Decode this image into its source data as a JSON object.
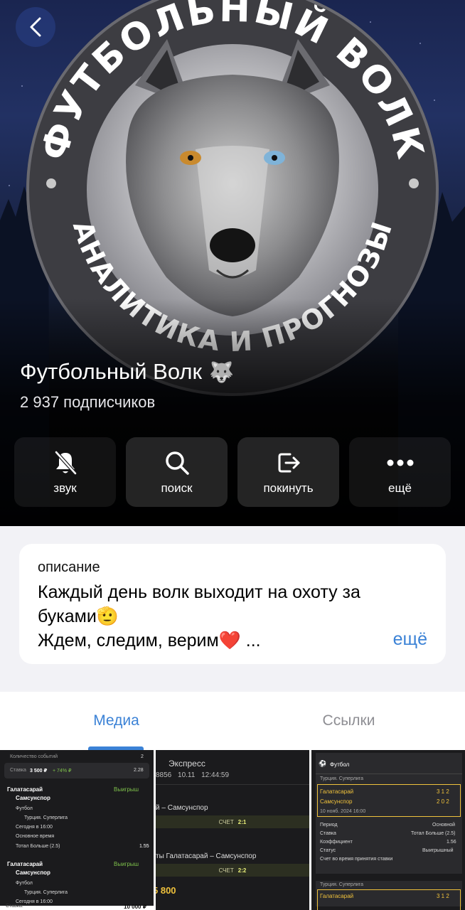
{
  "channel": {
    "name": "Футбольный Волк",
    "name_emoji": "🐺",
    "subscribers": "2 937 подписчиков",
    "logo_text_top": "ФУТБОЛЬНЫЙ ВОЛК",
    "logo_text_bottom": "АНАЛИТИКА И ПРОГНОЗЫ"
  },
  "actions": [
    {
      "label": "звук",
      "icon": "bell-muted-icon"
    },
    {
      "label": "поиск",
      "icon": "search-icon"
    },
    {
      "label": "покинуть",
      "icon": "leave-icon"
    },
    {
      "label": "ещё",
      "icon": "more-icon"
    }
  ],
  "description": {
    "label": "описание",
    "line1": "Каждый день волк выходит на охоту за",
    "line2": "буками",
    "line2_emoji": "🫡",
    "line3": "Ждем, следим, верим",
    "line3_emoji": "❤️",
    "ellipsis": " ...",
    "more": "ещё"
  },
  "tabs": [
    {
      "label": "Медиа",
      "active": true
    },
    {
      "label": "Ссылки",
      "active": false
    }
  ],
  "media": {
    "t1": {
      "events_label": "Количество событий",
      "events_value": "2",
      "stake_label": "Ставка",
      "stake_value": "3 500 ₽",
      "stake_pct": "+ 74% ₽",
      "coef": "2.28",
      "match1_team1": "Галатасарай",
      "match1_team2": "Самсунспор",
      "match1_result": "Выигрыш",
      "sport": "Футбол",
      "league": "Турция. Суперлига",
      "time": "Сегодня в 16:00",
      "period": "Основное время",
      "bet": "Тотал Больше (2.5)",
      "bet_coef": "1.55",
      "match2_team1": "Галатасарай",
      "match2_team2": "Самсунспор",
      "match2_result": "Выигрыш",
      "sport2": "Футбол",
      "league2": "Турция. Суперлига",
      "time2": "Сегодня в 16:00",
      "stake2_label": "Ставка:",
      "stake2_value": "10 000 ₽"
    },
    "t2": {
      "title": "Экспресс",
      "id": "8856",
      "date": "10.11",
      "time": "12:44:59",
      "match1": "й – Самсунспор",
      "score1_label": "СЧЕТ",
      "score1": "2:1",
      "match2": "ты Галатасарай – Самсунспор",
      "score2_label": "СЧЕТ",
      "score2": "2:2",
      "amount": "5 800"
    },
    "t3": {
      "sport": "Футбол",
      "league": "Турция. Суперлига",
      "team1": "Галатасарай",
      "team1_score": "3 1 2",
      "team2": "Самсунспор",
      "team2_score": "2 0 2",
      "date": "10 нояб. 2024 16:00",
      "period_label": "Период",
      "period_value": "Основной",
      "bet_label": "Ставка",
      "bet_value": "Тотал Больше (2.5)",
      "coef_label": "Коэффициент",
      "coef_value": "1.56",
      "status_label": "Статус",
      "status_value": "Выигрышный",
      "score_label": "Счет во время принятия ставки",
      "league2": "Турция. Суперлига",
      "team3": "Галатасарай",
      "team3_score": "3 1 2"
    }
  },
  "colors": {
    "accent": "#3b82d6",
    "card_bg": "#ffffff",
    "page_bg": "#f2f2f6"
  }
}
